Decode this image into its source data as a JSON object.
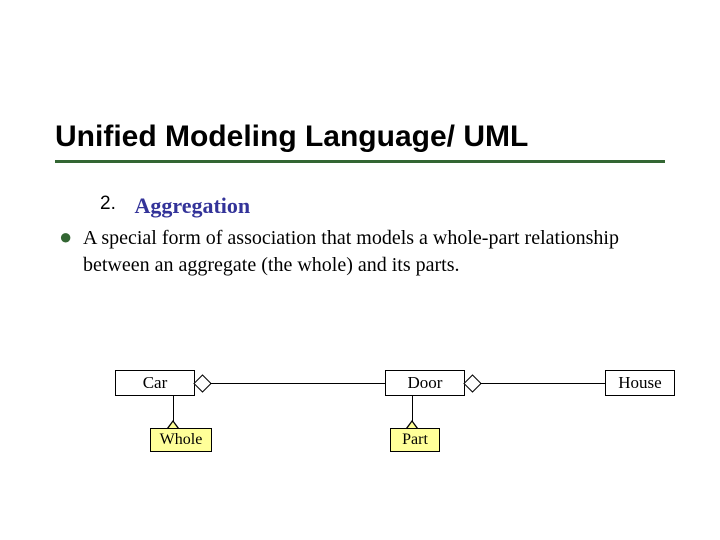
{
  "title": "Unified Modeling Language/ UML",
  "item_number": "2.",
  "heading": "Aggregation",
  "description": "A special form of association that models a whole-part relationship between an aggregate (the whole) and its parts.",
  "boxes": {
    "car": "Car",
    "door": "Door",
    "house": "House"
  },
  "callouts": {
    "whole": "Whole",
    "part": "Part"
  }
}
